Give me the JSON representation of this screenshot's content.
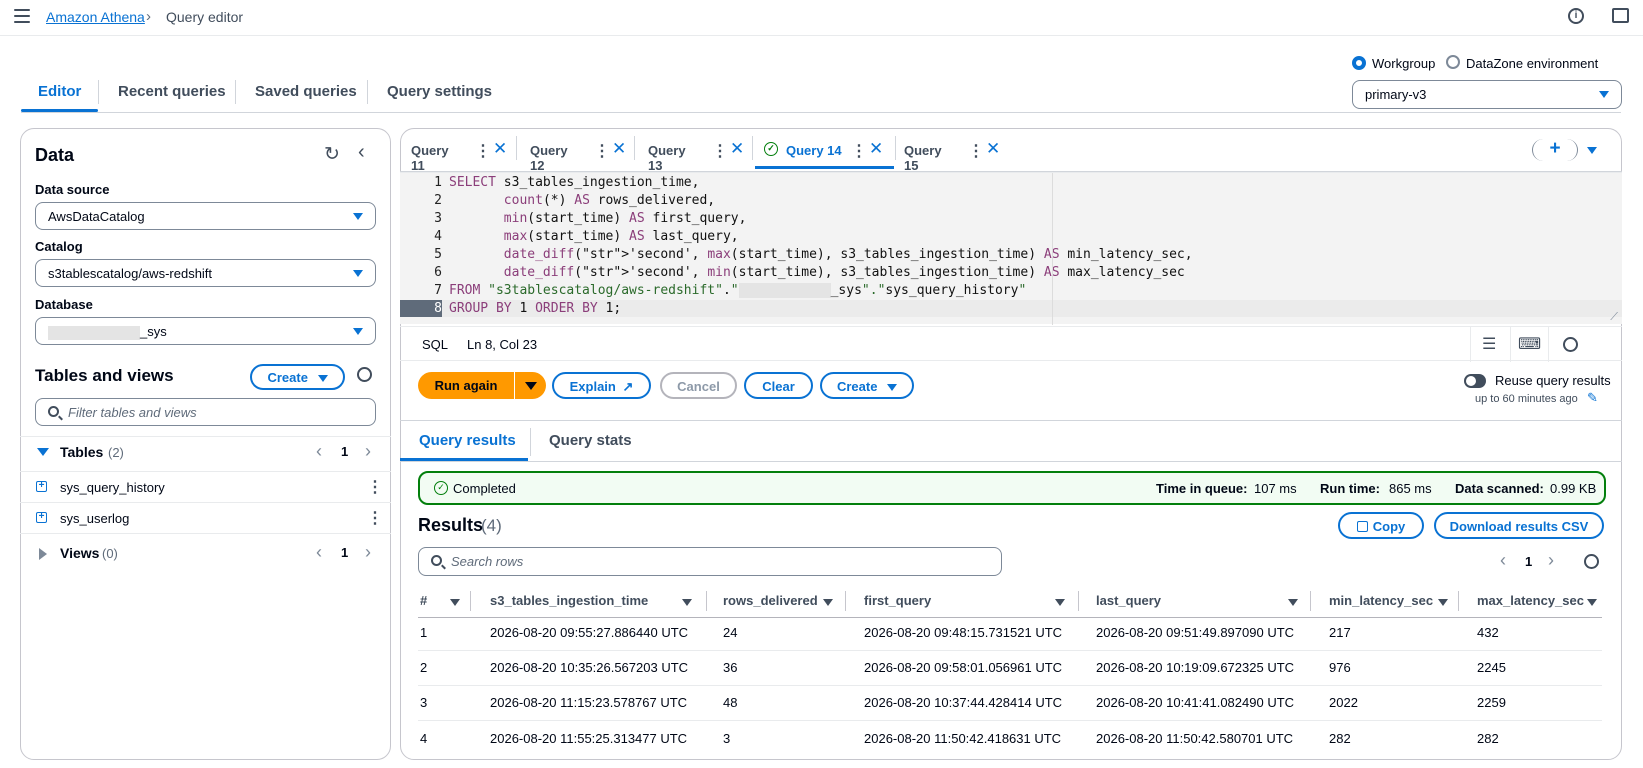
{
  "breadcrumb": {
    "root": "Amazon Athena",
    "current": "Query editor"
  },
  "nav_tabs": [
    "Editor",
    "Recent queries",
    "Saved queries",
    "Query settings"
  ],
  "workgroup": {
    "option1": "Workgroup",
    "option2": "DataZone environment",
    "selected": "primary-v3"
  },
  "data_panel": {
    "title": "Data",
    "data_source_label": "Data source",
    "data_source": "AwsDataCatalog",
    "catalog_label": "Catalog",
    "catalog": "s3tablescatalog/aws-redshift",
    "database_label": "Database",
    "database_suffix": "_sys",
    "tables_views_title": "Tables and views",
    "create_label": "Create",
    "filter_placeholder": "Filter tables and views",
    "tables_label": "Tables",
    "tables_count": "(2)",
    "tables_page": "1",
    "tables": [
      "sys_query_history",
      "sys_userlog"
    ],
    "views_label": "Views",
    "views_count": "(0)",
    "views_page": "1"
  },
  "query_tabs": [
    "Query 11",
    "Query 12",
    "Query 13",
    "Query 14",
    "Query 15"
  ],
  "active_query_tab": "Query 14",
  "editor": {
    "line_numbers": [
      "1",
      "2",
      "3",
      "4",
      "5",
      "6",
      "7",
      "8"
    ],
    "lines": [
      "SELECT s3_tables_ingestion_time,",
      "       count(*) AS rows_delivered,",
      "       min(start_time) AS first_query,",
      "       max(start_time) AS last_query,",
      "       date_diff('second', max(start_time), s3_tables_ingestion_time) AS min_latency_sec,",
      "       date_diff('second', min(start_time), s3_tables_ingestion_time) AS max_latency_sec",
      "FROM \"s3tablescatalog/aws-redshift\".\"",
      "GROUP BY 1 ORDER BY 1;"
    ],
    "line7_tail": "_sys\".\"sys_query_history\"",
    "language": "SQL",
    "cursor": "Ln 8, Col 23"
  },
  "actions": {
    "run": "Run again",
    "explain": "Explain",
    "cancel": "Cancel",
    "clear": "Clear",
    "create": "Create",
    "reuse_label": "Reuse query results",
    "reuse_sub": "up to 60 minutes ago"
  },
  "result_tabs": [
    "Query results",
    "Query stats"
  ],
  "status": {
    "text": "Completed",
    "queue_label": "Time in queue:",
    "queue_value": "107 ms",
    "run_label": "Run time:",
    "run_value": "865 ms",
    "scanned_label": "Data scanned:",
    "scanned_value": "0.99 KB"
  },
  "results": {
    "title": "Results",
    "count": "(4)",
    "copy": "Copy",
    "download": "Download results CSV",
    "search_placeholder": "Search rows",
    "page": "1",
    "columns": [
      "#",
      "s3_tables_ingestion_time",
      "rows_delivered",
      "first_query",
      "last_query",
      "min_latency_sec",
      "max_latency_sec"
    ],
    "rows": [
      [
        "1",
        "2026-08-20 09:55:27.886440 UTC",
        "24",
        "2026-08-20 09:48:15.731521 UTC",
        "2026-08-20 09:51:49.897090 UTC",
        "217",
        "432"
      ],
      [
        "2",
        "2026-08-20 10:35:26.567203 UTC",
        "36",
        "2026-08-20 09:58:01.056961 UTC",
        "2026-08-20 10:19:09.672325 UTC",
        "976",
        "2245"
      ],
      [
        "3",
        "2026-08-20 11:15:23.578767 UTC",
        "48",
        "2026-08-20 10:37:44.428414 UTC",
        "2026-08-20 10:41:41.082490 UTC",
        "2022",
        "2259"
      ],
      [
        "4",
        "2026-08-20 11:55:25.313477 UTC",
        "3",
        "2026-08-20 11:50:42.418631 UTC",
        "2026-08-20 11:50:42.580701 UTC",
        "282",
        "282"
      ]
    ]
  },
  "colors": {
    "accent": "#0972d3",
    "primary_button": "#ff9900",
    "success": "#037f0c"
  }
}
